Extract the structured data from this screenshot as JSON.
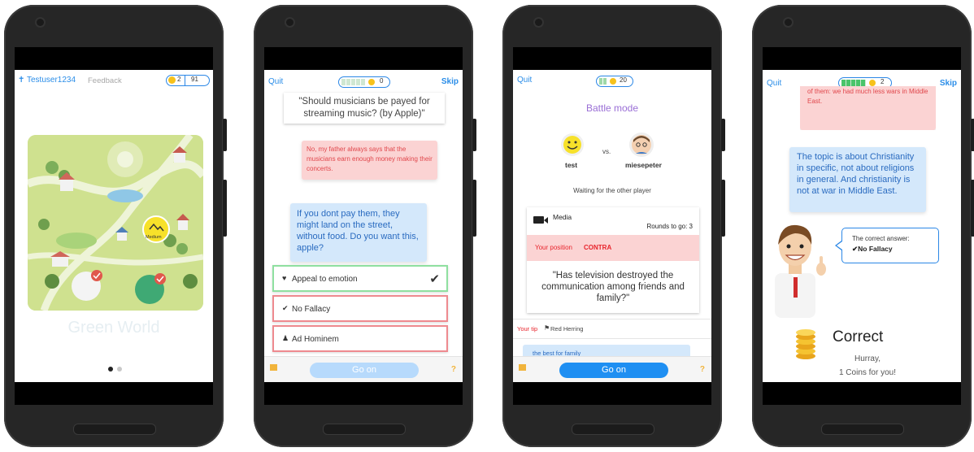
{
  "screen1": {
    "username": "Testuser1234",
    "feedback": "Feedback",
    "coins": "2",
    "score": "91",
    "badge_medium": "Medium",
    "world_title": "Green World",
    "pager": [
      "active",
      "inactive"
    ]
  },
  "screen2": {
    "quit": "Quit",
    "skip": "Skip",
    "progress_value": "0",
    "question": "\"Should musicians be payed for streaming music? (by Apple)\"",
    "bubble_red": "No, my father always says that the musicians earn enough money making their concerts.",
    "bubble_blue": "If you dont pay them, they might land on the street, without food. Do you want this, apple?",
    "options": [
      {
        "label": "Appeal to emotion",
        "icon": "heart-icon",
        "state": "correct"
      },
      {
        "label": "No Fallacy",
        "icon": "check-icon",
        "state": "wrong"
      },
      {
        "label": "Ad Hominem",
        "icon": "person-icon",
        "state": "wrong"
      }
    ],
    "go_on": "Go on",
    "help": "?"
  },
  "screen3": {
    "quit": "Quit",
    "progress_value": "20",
    "title": "Battle mode",
    "player1": "test",
    "vs": "vs.",
    "player2": "miesepeter",
    "waiting": "Waiting for the other player",
    "category": "Media",
    "rounds": "Rounds to go: 3",
    "position_label": "Your position",
    "position_value": "CONTRA",
    "question": "\"Has television destroyed the communication among friends and family?\"",
    "tip_label": "Your tip",
    "tip_value": "Red Herring",
    "peek_text": "the best for family",
    "go_on": "Go on",
    "help": "?"
  },
  "screen4": {
    "quit": "Quit",
    "skip": "Skip",
    "progress_value": "2",
    "bubble_red": "All these religions... What if we had none of them: we had much less wars in Middle East.",
    "bubble_blue": "The topic is about Christianity in specific, not about religions in general. And christianity is not at war in Middle East.",
    "correct_answer_label": "The correct answer:",
    "correct_answer_value": "✔No Fallacy",
    "result_title": "Correct",
    "result_line1": "Hurray,",
    "result_line2": "1 Coins for you!"
  },
  "colors": {
    "accent_blue": "#2a8de8",
    "button_blue": "#1f8ff2",
    "button_disabled": "#b7dafc",
    "correct_green": "#8fe0a0",
    "wrong_red": "#ee8a8f",
    "contra_red": "#e8242c"
  }
}
